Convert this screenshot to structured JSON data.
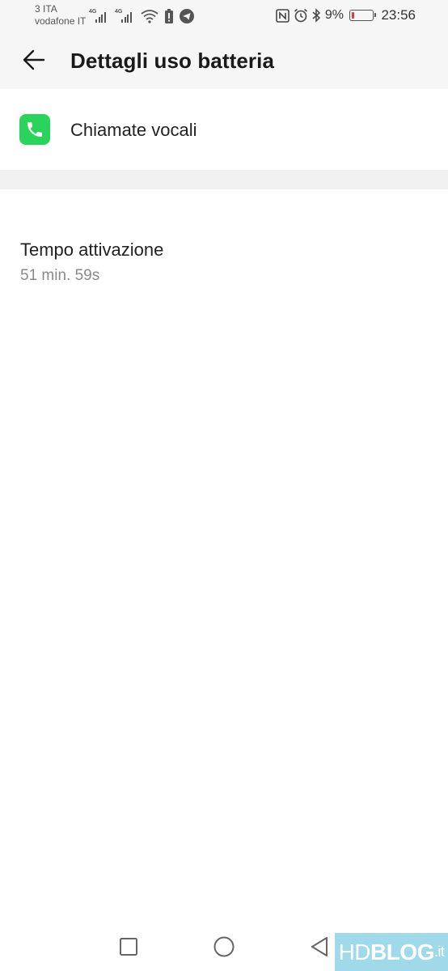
{
  "status_bar": {
    "carrier_1": "3 ITA",
    "carrier_2": "vodafone IT",
    "signal_1_tag": "4G",
    "signal_2_tag": "4G",
    "battery_percent": "9%",
    "battery_level": 0.09,
    "time": "23:56",
    "icons": [
      "signal-icon",
      "signal-icon",
      "wifi-icon",
      "battery-saver-icon",
      "telegram-icon",
      "nfc-icon",
      "alarm-icon",
      "bluetooth-icon",
      "battery-icon"
    ]
  },
  "app_bar": {
    "title": "Dettagli uso batteria"
  },
  "app": {
    "name": "Chiamate vocali",
    "icon": "phone-icon",
    "icon_color": "#2ad35b"
  },
  "detail": {
    "label": "Tempo attivazione",
    "value": "51 min. 59s"
  },
  "nav": {
    "icons": [
      "recents-icon",
      "home-icon",
      "back-icon"
    ]
  },
  "watermark": {
    "part1": "HD",
    "part2": "BLOG",
    "part3": ".it"
  },
  "colors": {
    "header_bg": "#f6f6f6",
    "battery_low": "#e53935",
    "watermark_bg": "#9fd9ea"
  }
}
